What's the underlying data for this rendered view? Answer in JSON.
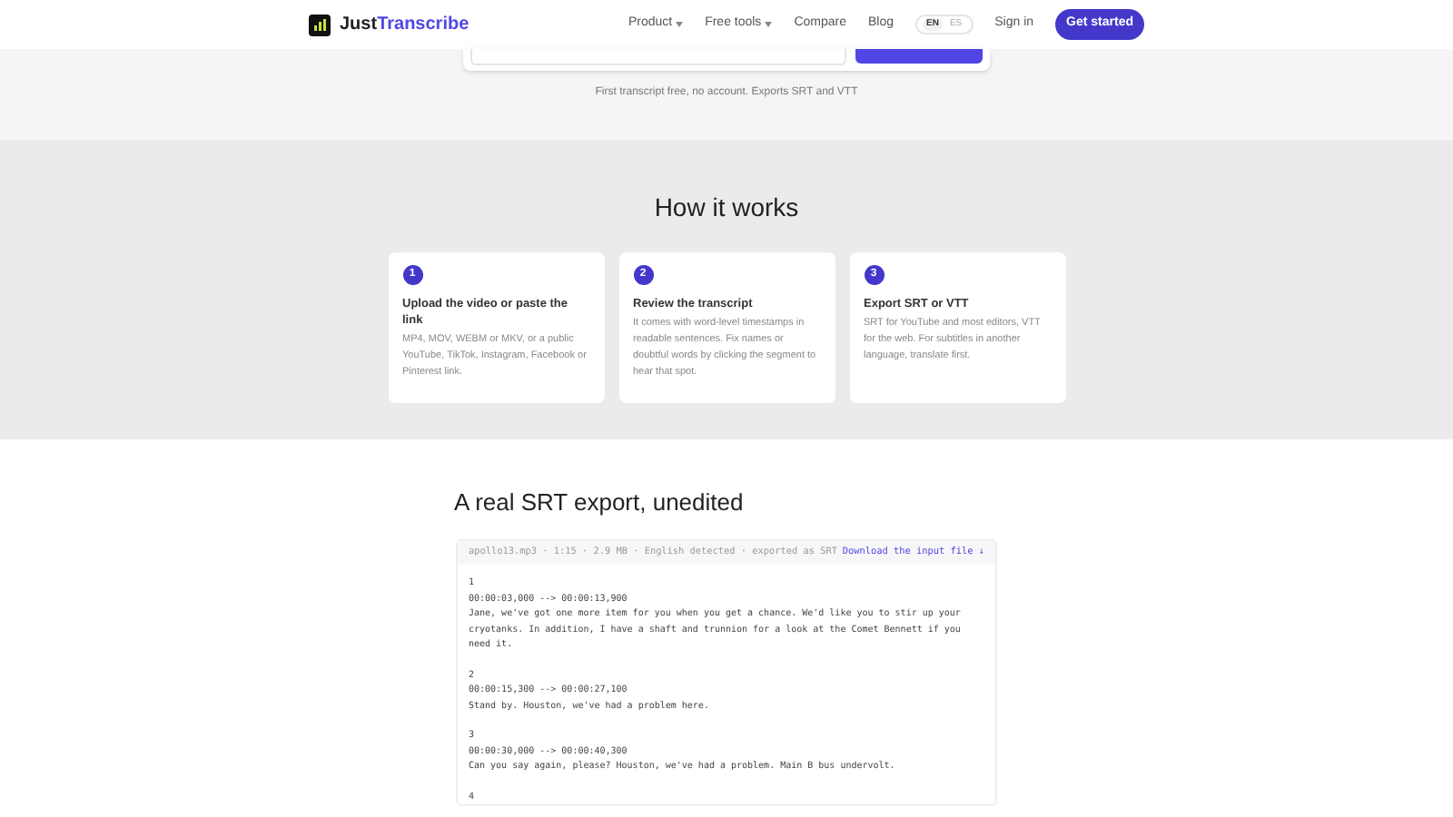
{
  "header": {
    "logo_prefix": "Just",
    "logo_accent": "Transcribe",
    "nav": [
      {
        "label": "Product",
        "dropdown": true
      },
      {
        "label": "Free tools",
        "dropdown": true
      },
      {
        "label": "Compare",
        "dropdown": false
      },
      {
        "label": "Blog",
        "dropdown": false
      }
    ],
    "languages": [
      {
        "label": "EN",
        "selected": true
      },
      {
        "label": "ES",
        "selected": false
      }
    ],
    "sign_in": "Sign in",
    "cta": "Get started"
  },
  "hero": {
    "note": "First transcript free, no account. Exports SRT and VTT"
  },
  "how": {
    "title": "How it works",
    "steps": [
      {
        "number": "1",
        "title": "Upload the video or paste the link",
        "text": "MP4, MOV, WEBM or MKV, or a public YouTube, TikTok, Instagram, Facebook or Pinterest link."
      },
      {
        "number": "2",
        "title": "Review the transcript",
        "text": "It comes with word-level timestamps in readable sentences. Fix names or doubtful words by clicking the segment to hear that spot."
      },
      {
        "number": "3",
        "title": "Export SRT or VTT",
        "text": "SRT for YouTube and most editors, VTT for the web. For subtitles in another language, translate first."
      }
    ]
  },
  "export": {
    "title": "A real SRT export, unedited",
    "meta": "apollo13.mp3 · 1:15 · 2.9 MB · English detected · exported as SRT",
    "download": "Download the input file ↓",
    "cues": [
      {
        "index": "1",
        "time": "00:00:03,000 --> 00:00:13,900",
        "text": "Jane, we've got one more item for you when you get a chance. We'd like you to stir up your cryotanks. In addition, I have a shaft and trunnion for a look at the Comet Bennett if you need it."
      },
      {
        "index": "2",
        "time": "00:00:15,300 --> 00:00:27,100",
        "text": "Stand by. Houston, we've had a problem here."
      },
      {
        "index": "3",
        "time": "00:00:30,000 --> 00:00:40,300",
        "text": "Can you say again, please? Houston, we've had a problem. Main B bus undervolt."
      },
      {
        "index": "4"
      }
    ]
  }
}
